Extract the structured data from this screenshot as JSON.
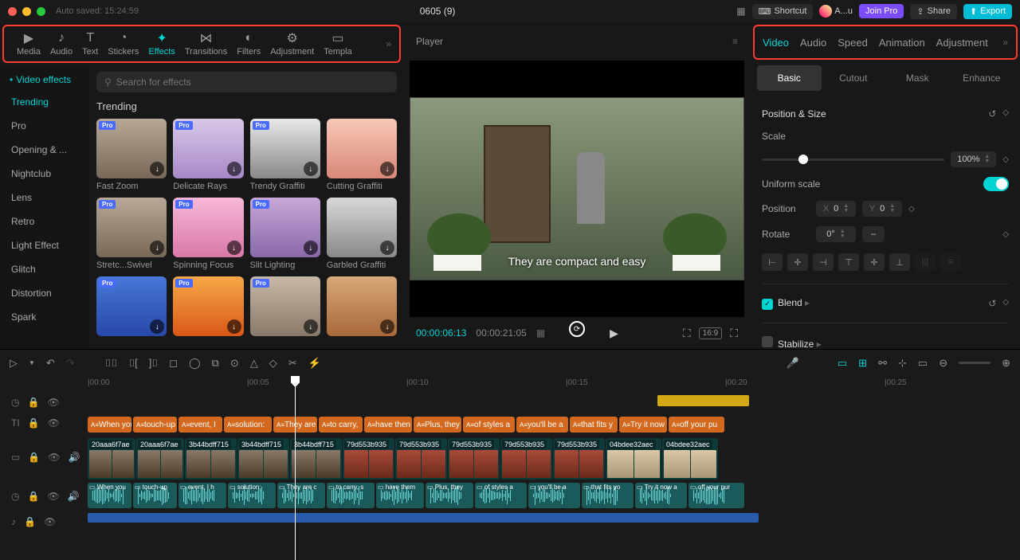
{
  "titlebar": {
    "auto_saved": "Auto saved: 15:24:59",
    "title": "0605 (9)",
    "shortcut": "Shortcut",
    "user": "A...u",
    "join_pro": "Join Pro",
    "share": "Share",
    "export": "Export"
  },
  "main_tabs": [
    "Media",
    "Audio",
    "Text",
    "Stickers",
    "Effects",
    "Transitions",
    "Filters",
    "Adjustment",
    "Templa"
  ],
  "main_tab_active": 4,
  "effects": {
    "sidebar_header": "Video effects",
    "categories": [
      "Trending",
      "Pro",
      "Opening & ...",
      "Nightclub",
      "Lens",
      "Retro",
      "Light Effect",
      "Glitch",
      "Distortion",
      "Spark"
    ],
    "active_category": 0,
    "search_placeholder": "Search for effects",
    "section_title": "Trending",
    "items": [
      {
        "name": "Fast Zoom",
        "pro": true
      },
      {
        "name": "Delicate Rays",
        "pro": true
      },
      {
        "name": "Trendy Graffiti",
        "pro": true
      },
      {
        "name": "Cutting Graffiti",
        "pro": false
      },
      {
        "name": "Stretc...Swivel",
        "pro": true
      },
      {
        "name": "Spinning Focus",
        "pro": true
      },
      {
        "name": "Slit Lighting",
        "pro": true
      },
      {
        "name": "Garbled Graffiti",
        "pro": false
      },
      {
        "name": "",
        "pro": true
      },
      {
        "name": "",
        "pro": true
      },
      {
        "name": "",
        "pro": true
      },
      {
        "name": "",
        "pro": false
      }
    ]
  },
  "player": {
    "label": "Player",
    "subtitle": "They are compact and easy",
    "current_time": "00:00:06:13",
    "duration": "00:00:21:05",
    "ratio": "16:9"
  },
  "right_tabs": [
    "Video",
    "Audio",
    "Speed",
    "Animation",
    "Adjustment"
  ],
  "right_tab_active": 0,
  "sub_tabs": [
    "Basic",
    "Cutout",
    "Mask",
    "Enhance"
  ],
  "sub_tab_active": 0,
  "props": {
    "position_size": "Position & Size",
    "scale": "Scale",
    "scale_value": "100%",
    "uniform_scale": "Uniform scale",
    "position": "Position",
    "x": "X",
    "x_val": "0",
    "y": "Y",
    "y_val": "0",
    "rotate": "Rotate",
    "rotate_val": "0°",
    "blend": "Blend",
    "stabilize": "Stabilize"
  },
  "ruler": [
    "|00:00",
    "|00:05",
    "|00:10",
    "|00:15",
    "|00:20",
    "|00:25"
  ],
  "subtitle_clips": [
    "When you",
    "touch-up",
    "event, I",
    "solution:",
    "They are",
    "to carry,",
    "have then",
    "Plus, they",
    "of styles a",
    "you'll be a",
    "that fits y",
    "Try it now",
    "off your pu"
  ],
  "video_clips": [
    "20aaa6f7ae",
    "20aaa6f7ae",
    "3b44bdff715",
    "3b44bdff715",
    "3b44bdff715",
    "79d553b935",
    "79d553b935",
    "79d553b935",
    "79d553b935",
    "79d553b935",
    "04bdee32aec",
    "04bdee32aec"
  ],
  "audio_clips": [
    "When you",
    "touch-up",
    "event, I h",
    "solution:",
    "They are c",
    "to carry, s",
    "have them",
    "Plus, they",
    "of styles a",
    "you'll be a",
    "that fits yo",
    "Try it now a",
    "off your pur"
  ]
}
